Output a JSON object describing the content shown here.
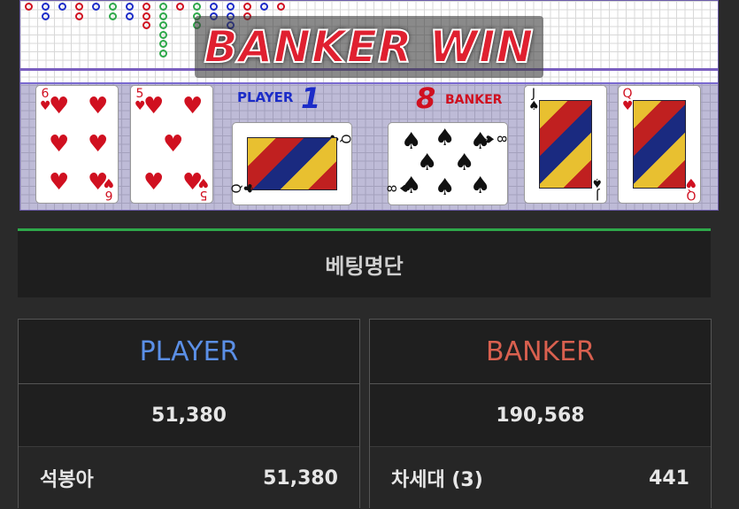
{
  "banner": {
    "text": "BANKER WIN"
  },
  "scoreboard": {
    "player_label": "PLAYER",
    "player_score": "1",
    "banker_label": "BANKER",
    "banker_score": "8"
  },
  "cards": {
    "player": [
      {
        "rank": "6",
        "suit": "♥",
        "color": "red"
      },
      {
        "rank": "5",
        "suit": "♥",
        "color": "red"
      },
      {
        "rank": "Q",
        "suit": "♣",
        "color": "black"
      }
    ],
    "banker": [
      {
        "rank": "8",
        "suit": "♠",
        "color": "black"
      },
      {
        "rank": "J",
        "suit": "♠",
        "color": "black"
      },
      {
        "rank": "Q",
        "suit": "♥",
        "color": "red"
      }
    ]
  },
  "betting_list": {
    "title": "베팅명단"
  },
  "columns": {
    "player": {
      "label": "PLAYER",
      "total": "51,380",
      "rows": [
        {
          "name": "석봉아",
          "amount": "51,380"
        }
      ]
    },
    "banker": {
      "label": "BANKER",
      "total": "190,568",
      "rows": [
        {
          "name": "차세대 (3)",
          "amount": "441"
        }
      ]
    }
  },
  "colors": {
    "player_accent": "#5b8fe6",
    "banker_accent": "#d9604f",
    "win_banner": "#e02030",
    "header_rule": "#2ea84a"
  }
}
